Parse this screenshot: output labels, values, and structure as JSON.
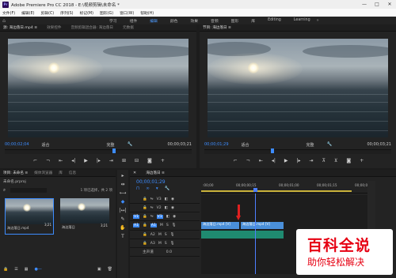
{
  "title_bar": {
    "logo_text": "Pr",
    "title": "Adobe Premiere Pro CC 2018 - E:\\视频剪辑\\未命名 *",
    "controls": [
      "—",
      "□",
      "✕"
    ]
  },
  "menu": {
    "items": [
      "文件(F)",
      "编辑(E)",
      "剪辑(C)",
      "序列(S)",
      "标记(M)",
      "图形(G)",
      "窗口(W)",
      "帮助(H)"
    ]
  },
  "workspace": {
    "home_icon": "home-icon",
    "items": [
      "学习",
      "组件",
      "编辑",
      "颜色",
      "效果",
      "音频",
      "图形",
      "库",
      "Editing",
      "Learning"
    ],
    "active_index": 2,
    "more": "»"
  },
  "source_monitor": {
    "tabs": [
      "源: 海边落日.mp4 ≡",
      "效果控件",
      "音频剪辑混合器: 海边落日",
      "元数据"
    ],
    "timecode_left": "00;00;02;04",
    "fit": "适合",
    "zoom": "完整",
    "timecode_right": "00;00;03;21"
  },
  "program_monitor": {
    "tabs": [
      "节目: 海边落日 ≡"
    ],
    "timecode_left": "00;00;01;29",
    "fit": "适合",
    "zoom": "完整",
    "timecode_right": "00;00;03;21"
  },
  "project_panel": {
    "tabs": [
      "项目: 未命名 ≡",
      "媒体浏览器",
      "库",
      "信息"
    ],
    "file": "未命名.prproj",
    "count": "1 项已选择，共 2 项",
    "items": [
      {
        "name": "海边落日.mp4",
        "duration": "3;21"
      },
      {
        "name": "海边落日",
        "duration": "3;21"
      }
    ]
  },
  "timeline": {
    "tab": "海边落日 ≡",
    "timecode": "00;00;01;29",
    "ruler_labels": [
      ":00;00",
      "00;00;00;15",
      "00;00;01;00",
      "00;00;01;15",
      "00;00;02;0"
    ],
    "video_tracks": [
      "V3",
      "V2",
      "V1"
    ],
    "audio_tracks": [
      "A1",
      "A2",
      "A3"
    ],
    "master_label": "主声道",
    "master_value": "0.0",
    "clip1_label": "海边落日.mp4 [V]",
    "clip2_label": "海边落日.mp4 [V]"
  },
  "tools": [
    "▸",
    "⇹",
    "⟷",
    "◆",
    "|↔|",
    "✎",
    "✋",
    "T"
  ],
  "watermark": {
    "line1": "百科全说",
    "line2": "助你轻松解决"
  },
  "colors": {
    "accent": "#3d8cff",
    "clip_video": "#4a8fd9",
    "clip_audio": "#1f8a70",
    "playhead": "#4d7fff",
    "watermark_red": "#e60012"
  }
}
